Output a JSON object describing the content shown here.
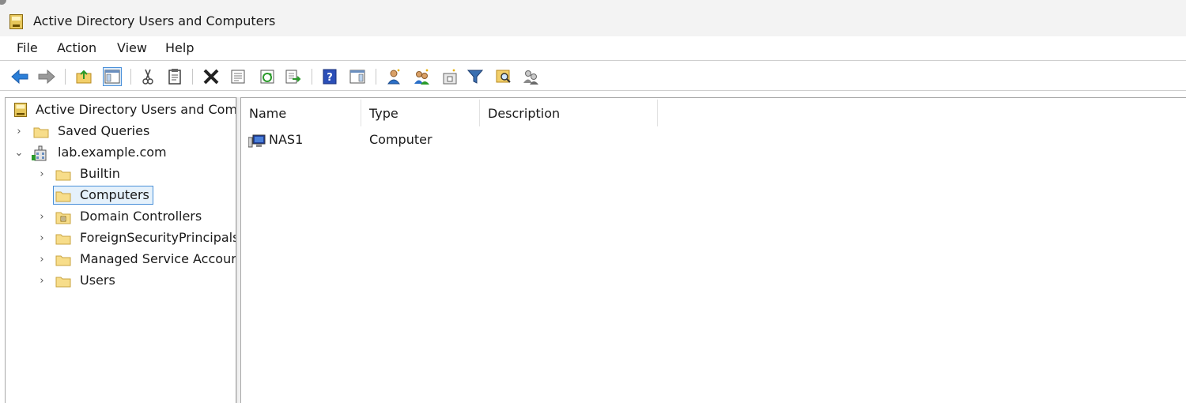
{
  "window": {
    "title": "Active Directory Users and Computers",
    "icon": "aduc-book-icon"
  },
  "menu": {
    "items": [
      "File",
      "Action",
      "View",
      "Help"
    ]
  },
  "toolbar": {
    "buttons": [
      {
        "name": "back-icon"
      },
      {
        "name": "forward-icon"
      },
      {
        "name": "up-one-level-icon"
      },
      {
        "name": "show-hide-console-tree-icon",
        "pressed": true
      },
      {
        "name": "cut-icon"
      },
      {
        "name": "copy-icon"
      },
      {
        "name": "delete-icon"
      },
      {
        "name": "properties-icon"
      },
      {
        "name": "refresh-icon"
      },
      {
        "name": "export-list-icon"
      },
      {
        "name": "help-icon"
      },
      {
        "name": "show-hide-action-pane-icon"
      },
      {
        "name": "create-user-icon"
      },
      {
        "name": "create-group-icon"
      },
      {
        "name": "create-ou-icon"
      },
      {
        "name": "filter-icon"
      },
      {
        "name": "find-icon"
      },
      {
        "name": "add-to-group-icon"
      }
    ]
  },
  "tree": {
    "root": "Active Directory Users and Com",
    "items": [
      {
        "label": "Saved Queries",
        "expander": "›",
        "icon": "folder-icon"
      },
      {
        "label": "lab.example.com",
        "expander": "⌄",
        "icon": "domain-icon"
      },
      {
        "label": "Builtin",
        "expander": "›",
        "icon": "folder-icon"
      },
      {
        "label": "Computers",
        "expander": "",
        "icon": "folder-icon",
        "selected": true
      },
      {
        "label": "Domain Controllers",
        "expander": "›",
        "icon": "ou-icon"
      },
      {
        "label": "ForeignSecurityPrincipals",
        "expander": "›",
        "icon": "folder-icon"
      },
      {
        "label": "Managed Service Accour",
        "expander": "›",
        "icon": "folder-icon"
      },
      {
        "label": "Users",
        "expander": "›",
        "icon": "folder-icon"
      }
    ]
  },
  "list": {
    "columns": [
      "Name",
      "Type",
      "Description"
    ],
    "rows": [
      {
        "name": "NAS1",
        "type": "Computer",
        "description": "",
        "icon": "computer-icon"
      }
    ]
  },
  "colors": {
    "selection_border": "#4a90d9",
    "selection_fill": "#e5f1fb",
    "folder": "#f7dd8a",
    "chrome": "#f3f3f3"
  }
}
